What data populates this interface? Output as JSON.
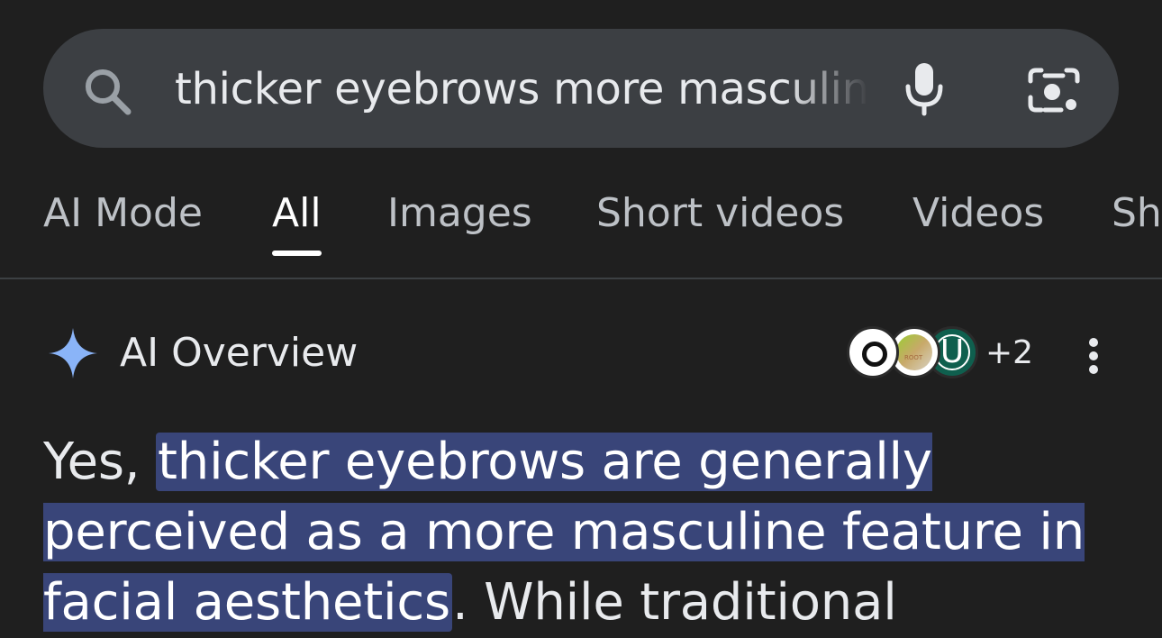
{
  "search": {
    "query": "thicker eyebrows more masculine",
    "search_icon": "search-icon",
    "mic_icon": "mic-icon",
    "lens_icon": "camera-lens-icon"
  },
  "tabs": [
    {
      "label": "AI Mode",
      "active": false
    },
    {
      "label": "All",
      "active": true
    },
    {
      "label": "Images",
      "active": false
    },
    {
      "label": "Short videos",
      "active": false
    },
    {
      "label": "Videos",
      "active": false
    },
    {
      "label": "Sh",
      "active": false
    }
  ],
  "ai_overview": {
    "title": "AI Overview",
    "sources_more": "+2",
    "avatar_3_letter": "U",
    "avatar_2_text": "ROOT"
  },
  "answer": {
    "prefix": "Yes, ",
    "highlight": "thicker eyebrows are generally perceived as a more masculine feature in facial aesthetics",
    "suffix": ". While traditional"
  },
  "colors": {
    "background": "#1f1f1f",
    "search_bar": "#3c3f43",
    "highlight": "#394579",
    "sparkle_blue": "#8ab4f8",
    "avatar_green": "#0f5f4e"
  }
}
